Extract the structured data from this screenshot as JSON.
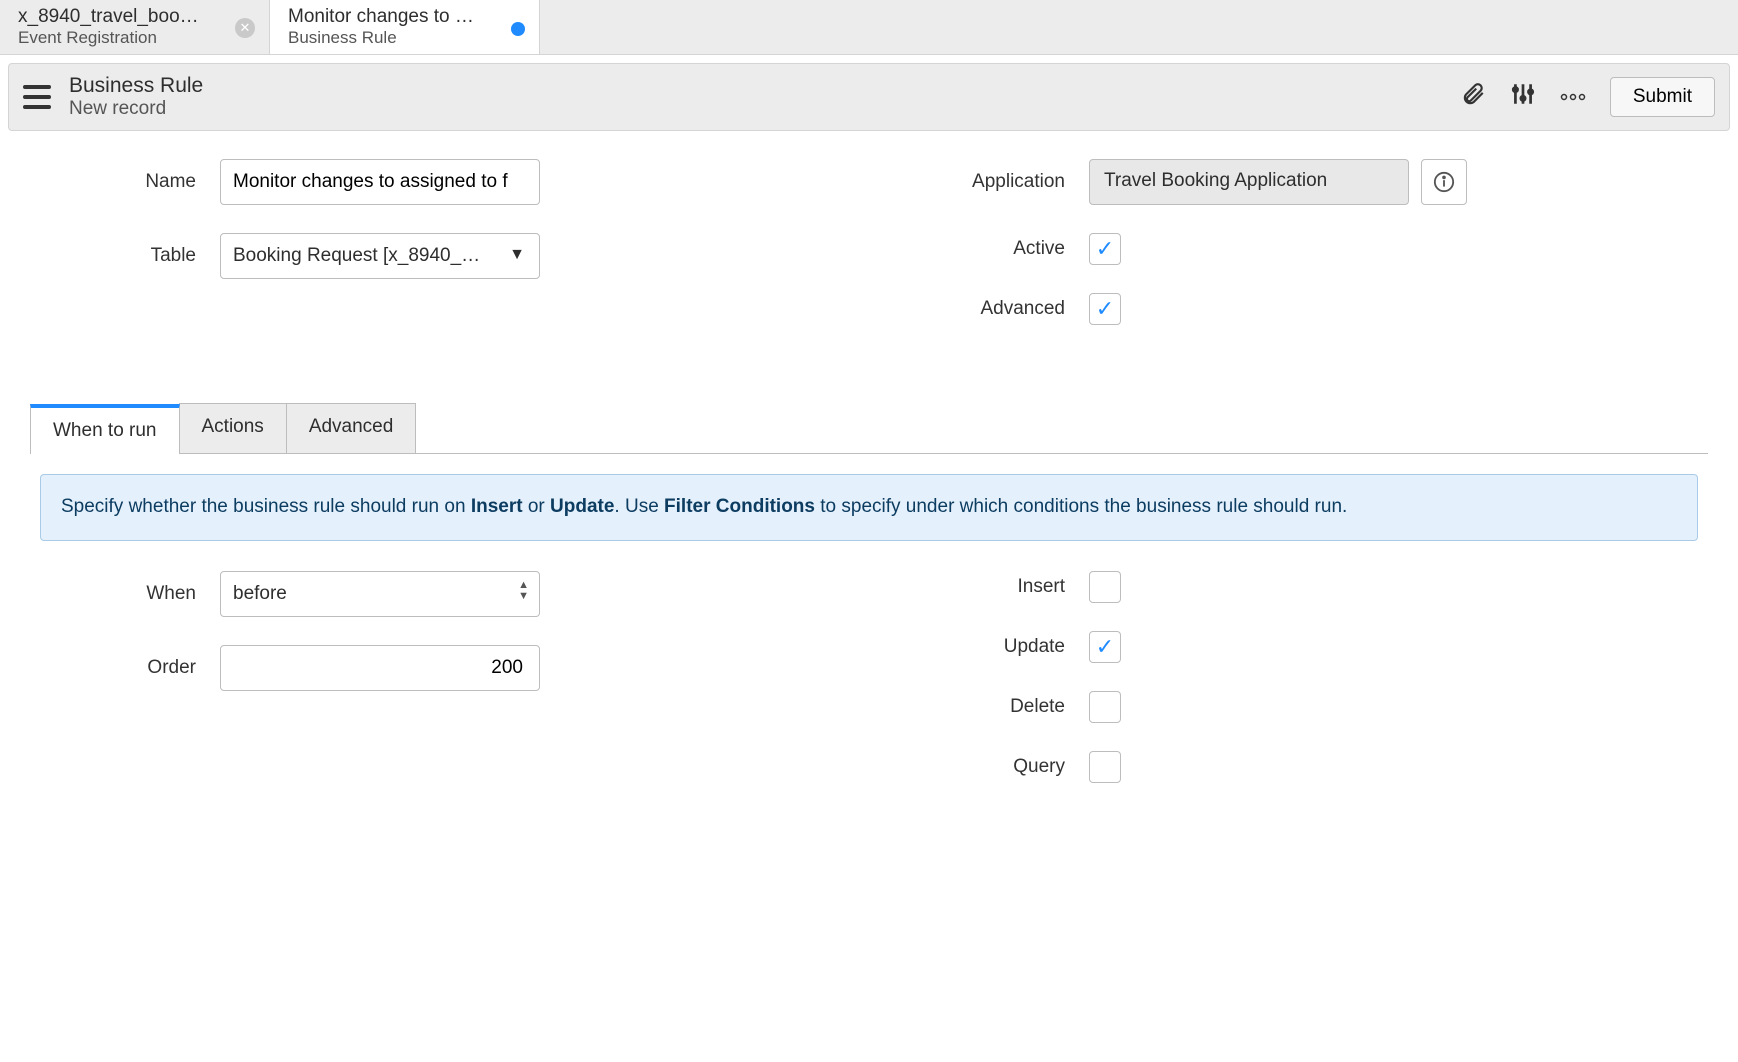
{
  "tabs": [
    {
      "title": "x_8940_travel_book…",
      "subtitle": "Event Registration"
    },
    {
      "title": "Monitor changes to …",
      "subtitle": "Business Rule"
    }
  ],
  "header": {
    "type": "Business Rule",
    "record": "New record",
    "submit_label": "Submit"
  },
  "fields": {
    "name_label": "Name",
    "name_value": "Monitor changes to assigned to f",
    "table_label": "Table",
    "table_value": "Booking Request [x_8940_…",
    "application_label": "Application",
    "application_value": "Travel Booking Application",
    "active_label": "Active",
    "active_checked": true,
    "advanced_label": "Advanced",
    "advanced_checked": true
  },
  "section_tabs": {
    "when_to_run": "When to run",
    "actions": "Actions",
    "advanced": "Advanced"
  },
  "banner": {
    "p1": "Specify whether the business rule should run on ",
    "b1": "Insert",
    "p2": " or ",
    "b2": "Update",
    "p3": ". Use ",
    "b3": "Filter Conditions",
    "p4": " to specify under which conditions the business rule should run."
  },
  "when_form": {
    "when_label": "When",
    "when_value": "before",
    "order_label": "Order",
    "order_value": "200",
    "insert_label": "Insert",
    "insert_checked": false,
    "update_label": "Update",
    "update_checked": true,
    "delete_label": "Delete",
    "delete_checked": false,
    "query_label": "Query",
    "query_checked": false
  }
}
